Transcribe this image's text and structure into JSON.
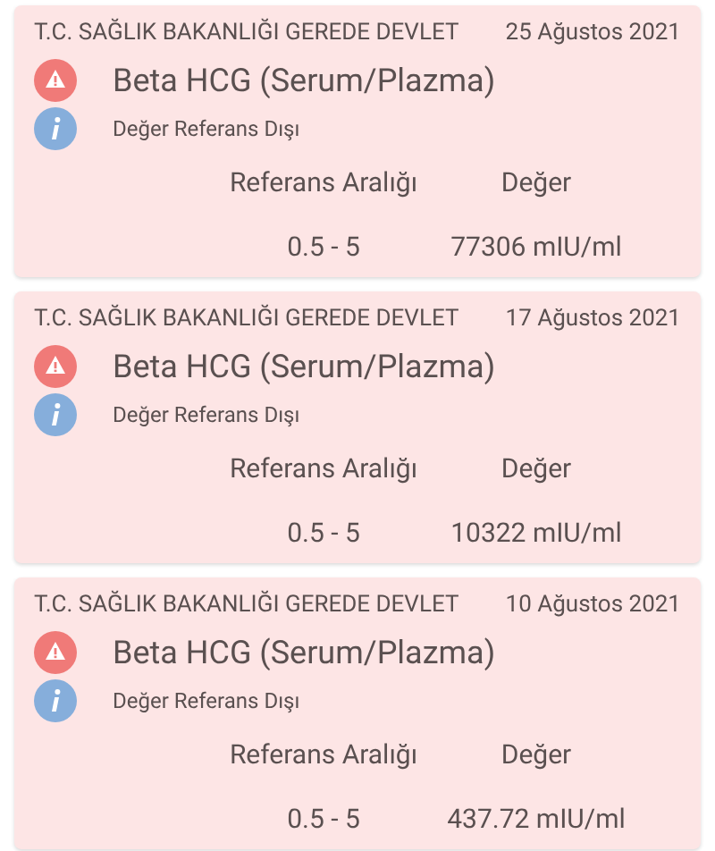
{
  "results": [
    {
      "institution": "T.C. SAĞLIK BAKANLIĞI GEREDE DEVLET",
      "date": "25 Ağustos 2021",
      "test": "Beta HCG (Serum/Plazma)",
      "status": "Değer Referans Dışı",
      "range_heading": "Referans Aralığı",
      "value_heading": "Değer",
      "range": "0.5 - 5",
      "value": "77306 mIU/ml"
    },
    {
      "institution": "T.C. SAĞLIK BAKANLIĞI GEREDE DEVLET",
      "date": "17 Ağustos 2021",
      "test": "Beta HCG (Serum/Plazma)",
      "status": "Değer Referans Dışı",
      "range_heading": "Referans Aralığı",
      "value_heading": "Değer",
      "range": "0.5 - 5",
      "value": "10322 mIU/ml"
    },
    {
      "institution": "T.C. SAĞLIK BAKANLIĞI GEREDE DEVLET",
      "date": "10 Ağustos 2021",
      "test": "Beta HCG (Serum/Plazma)",
      "status": "Değer Referans Dışı",
      "range_heading": "Referans Aralığı",
      "value_heading": "Değer",
      "range": "0.5 - 5",
      "value": "437.72 mIU/ml"
    }
  ]
}
